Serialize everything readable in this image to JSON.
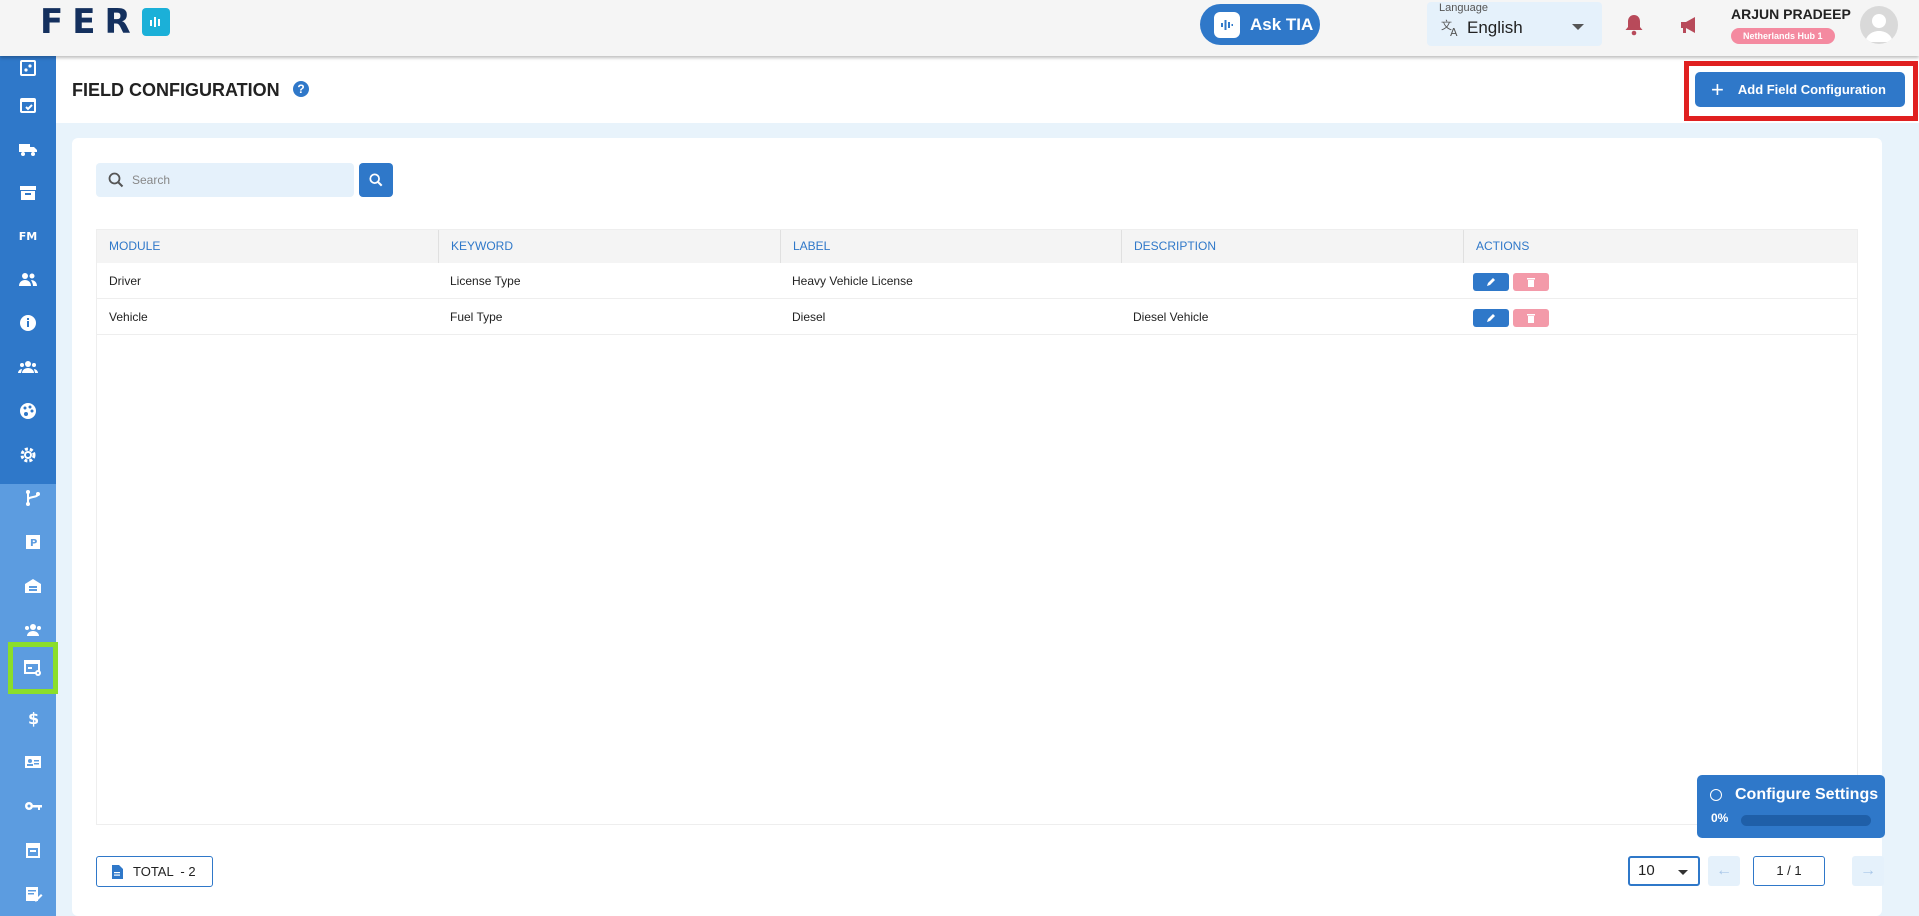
{
  "topbar": {
    "logo_text": "FER",
    "ask_tia_label": "Ask TIA",
    "language_caption": "Language",
    "language_value": "English",
    "user_name": "ARJUN PRADEEP",
    "user_hub": "Netherlands Hub 1"
  },
  "sidebar": {
    "items": [
      {
        "icon": "dashboard-chart-icon"
      },
      {
        "icon": "calendar-icon"
      },
      {
        "icon": "truck-icon"
      },
      {
        "icon": "archive-icon"
      },
      {
        "icon": "fm-text-icon",
        "label": "FM"
      },
      {
        "icon": "people-icon"
      },
      {
        "icon": "info-icon"
      },
      {
        "icon": "group-icon"
      },
      {
        "icon": "palette-icon"
      },
      {
        "icon": "gear-icon"
      },
      {
        "icon": "route-icon"
      },
      {
        "icon": "parking-icon"
      },
      {
        "icon": "warehouse-icon"
      },
      {
        "icon": "team-icon"
      },
      {
        "icon": "field-config-icon"
      },
      {
        "icon": "dollar-icon"
      },
      {
        "icon": "id-card-icon"
      },
      {
        "icon": "key-icon"
      },
      {
        "icon": "inbox-icon"
      },
      {
        "icon": "note-edit-icon"
      }
    ]
  },
  "header": {
    "title": "FIELD CONFIGURATION",
    "help_symbol": "?",
    "add_button_label": "Add Field Configuration"
  },
  "search": {
    "placeholder": "Search",
    "value": ""
  },
  "table": {
    "columns": [
      "MODULE",
      "KEYWORD",
      "LABEL",
      "DESCRIPTION",
      "ACTIONS"
    ],
    "rows": [
      {
        "module": "Driver",
        "keyword": "License Type",
        "label": "Heavy Vehicle License",
        "description": ""
      },
      {
        "module": "Vehicle",
        "keyword": "Fuel Type",
        "label": "Diesel",
        "description": "Diesel Vehicle"
      }
    ]
  },
  "footer": {
    "total_label": "TOTAL  - 2",
    "page_size": "10",
    "page_info": "1 / 1"
  },
  "configure_settings": {
    "title": "Configure Settings",
    "progress_text": "0%",
    "progress": 0
  },
  "colors": {
    "primary": "#2f78c9",
    "sidebar_lower": "#5c9ce0",
    "danger_soft": "#f39aa9",
    "highlight_red": "#e02020",
    "highlight_green": "#8bde2a"
  }
}
